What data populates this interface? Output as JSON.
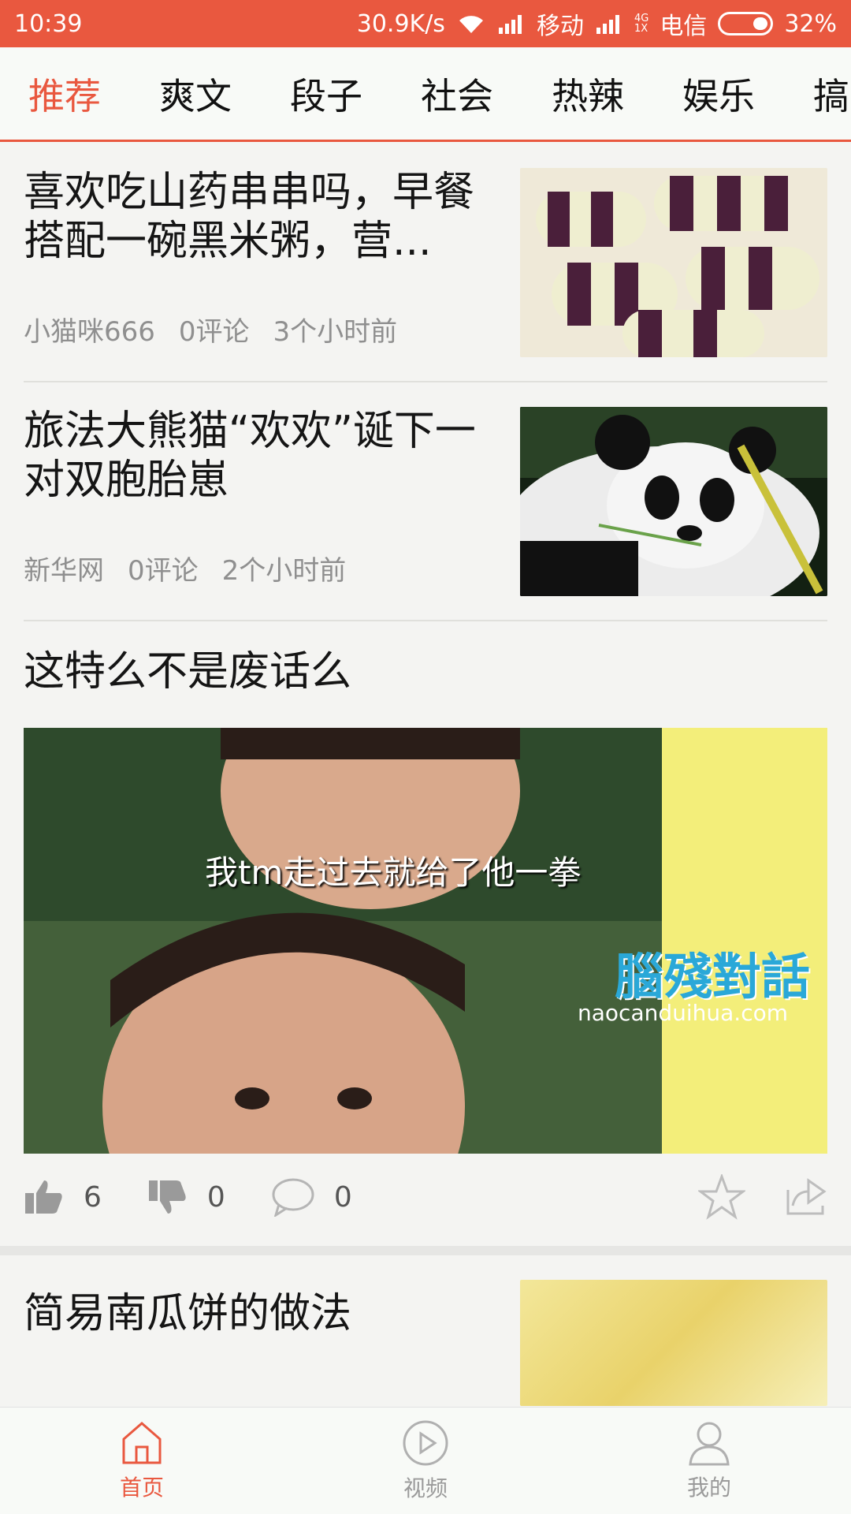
{
  "status_bar": {
    "time": "10:39",
    "speed": "30.9K/s",
    "carrier1": "移动",
    "net_top": "4G",
    "net_bottom": "1X",
    "carrier2": "电信",
    "battery": "32%"
  },
  "tabs": [
    "推荐",
    "爽文",
    "段子",
    "社会",
    "热辣",
    "娱乐",
    "搞"
  ],
  "articles": [
    {
      "title": "喜欢吃山药串串吗，早餐搭配一碗黑米粥，营...",
      "author": "小猫咪666",
      "comments": "0评论",
      "time": "3个小时前",
      "thumb": "purple-yam-rolls"
    },
    {
      "title": "旅法大熊猫“欢欢”诞下一对双胞胎崽",
      "author": "新华网",
      "comments": "0评论",
      "time": "2个小时前",
      "thumb": "panda"
    }
  ],
  "joke_post": {
    "title": "这特么不是废话么",
    "meme_caption": "我tm走过去就给了他一拳",
    "meme_brand": "腦殘對話",
    "meme_url": "naocanduihua.com",
    "likes": "6",
    "dislikes": "0",
    "comments": "0"
  },
  "article_next": {
    "title": "简易南瓜饼的做法"
  },
  "bottom_nav": [
    {
      "label": "首页",
      "icon": "home-icon",
      "active": true
    },
    {
      "label": "视频",
      "icon": "play-icon",
      "active": false
    },
    {
      "label": "我的",
      "icon": "user-icon",
      "active": false
    }
  ],
  "colors": {
    "accent": "#e9583f",
    "text": "#1a1a1a",
    "meta": "#8f8f8f"
  }
}
